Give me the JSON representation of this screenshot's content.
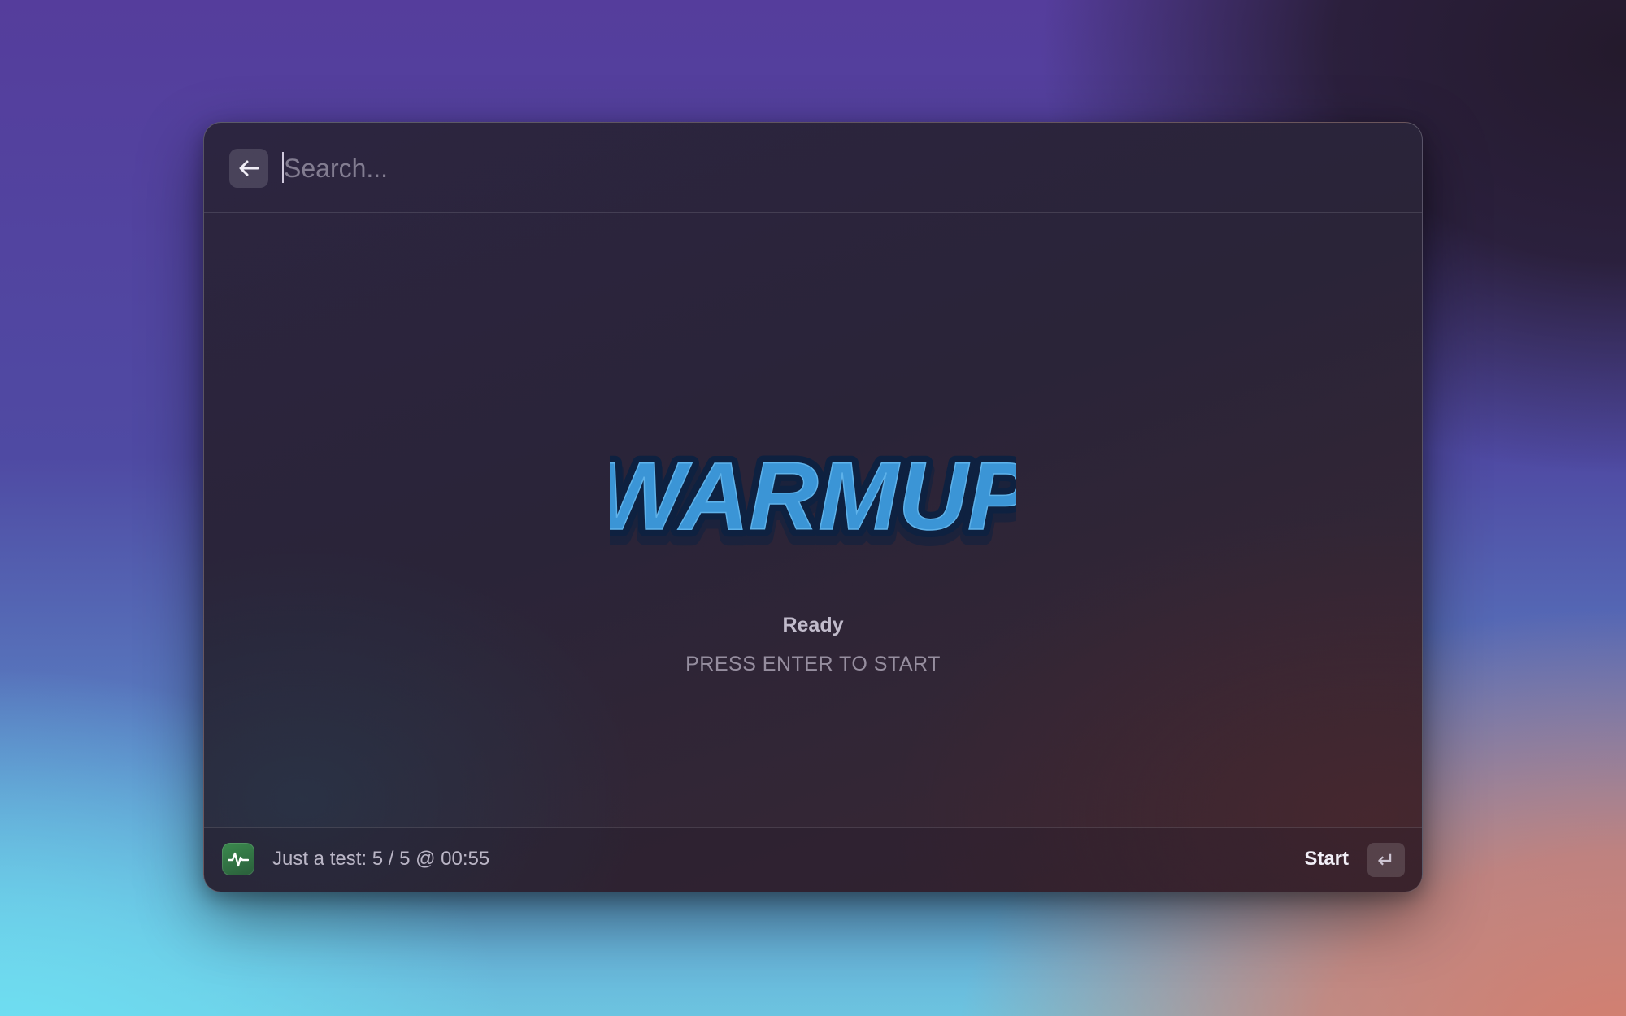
{
  "search": {
    "placeholder": "Search...",
    "value": ""
  },
  "icons": {
    "back": "arrow-left-icon",
    "app": "activity-pulse-icon",
    "enter": "return-key-icon"
  },
  "logo": {
    "text": "WARMUP",
    "fill_color": "#3b95d6",
    "outline_color": "#0e2140"
  },
  "status": {
    "title": "Ready",
    "subtitle": "PRESS ENTER TO START"
  },
  "footer": {
    "status_text": "Just a test: 5 / 5 @ 00:55",
    "action_label": "Start",
    "enter_key_glyph": "↵"
  },
  "colors": {
    "app_icon": "#3b8a4e",
    "window_bg": "#2c2540"
  }
}
